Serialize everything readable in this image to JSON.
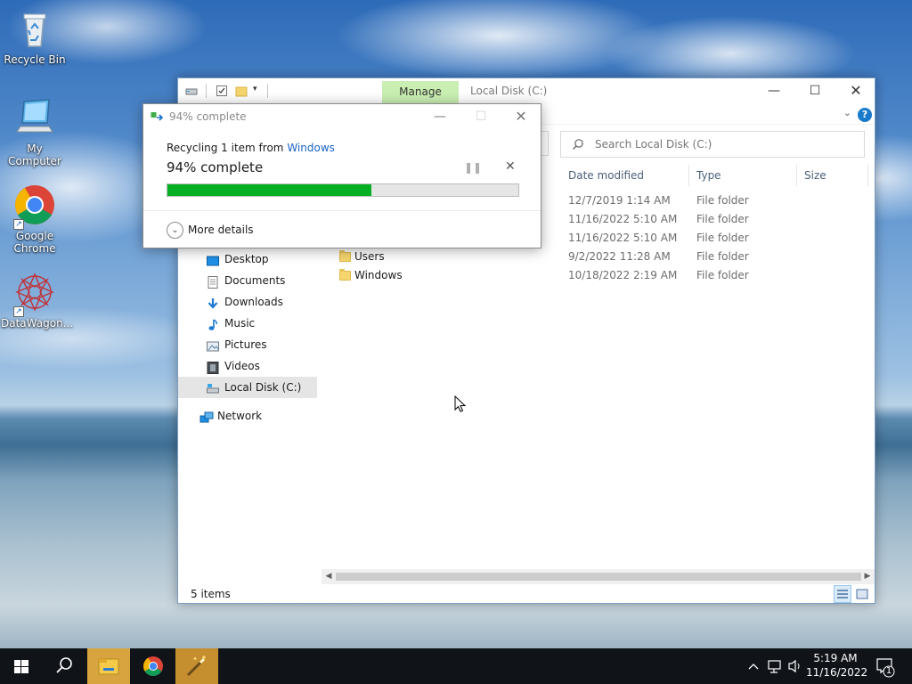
{
  "desktop": {
    "icons": [
      {
        "label": "Recycle Bin",
        "icon": "recycle-bin-icon"
      },
      {
        "label": "My Computer",
        "icon": "computer-icon"
      },
      {
        "label": "Google Chrome",
        "icon": "chrome-icon"
      },
      {
        "label": "DataWagon...",
        "icon": "datawagon-icon"
      }
    ]
  },
  "explorer": {
    "manage_tab": "Manage",
    "title": "Local Disk (C:)",
    "help": "?",
    "search_placeholder": "Search Local Disk (C:)",
    "columns": {
      "date_modified": "Date modified",
      "type": "Type",
      "size": "Size"
    },
    "rows": [
      {
        "name": "",
        "date": "12/7/2019 1:14 AM",
        "type": "File folder"
      },
      {
        "name": "",
        "date": "11/16/2022 5:10 AM",
        "type": "File folder"
      },
      {
        "name": "",
        "date": "11/16/2022 5:10 AM",
        "type": "File folder"
      },
      {
        "name": "Users",
        "date": "9/2/2022 11:28 AM",
        "type": "File folder"
      },
      {
        "name": "Windows",
        "date": "10/18/2022 2:19 AM",
        "type": "File folder"
      }
    ],
    "nav": {
      "desktop": "Desktop",
      "documents": "Documents",
      "downloads": "Downloads",
      "music": "Music",
      "pictures": "Pictures",
      "videos": "Videos",
      "local_disk": "Local Disk (C:)",
      "network": "Network"
    },
    "status": "5 items"
  },
  "progress_dialog": {
    "title": "94% complete",
    "from_prefix": "Recycling 1 item from ",
    "from_location": "Windows",
    "percent_label": "94% complete",
    "progress": 0.58,
    "more_details": "More details"
  },
  "taskbar": {
    "time": "5:19 AM",
    "date": "11/16/2022",
    "notification_count": "1"
  },
  "colors": {
    "progress_fill": "#06b025",
    "manage_tab": "#c9efb2",
    "link": "#1a64c8",
    "taskbar": "#101318",
    "active_app": "#d7a43f"
  }
}
